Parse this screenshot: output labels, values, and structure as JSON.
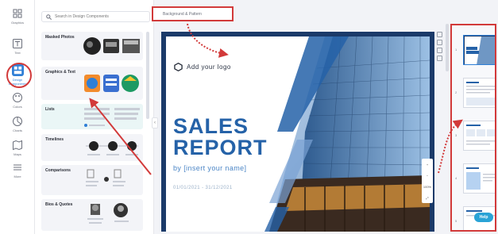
{
  "rail": {
    "items": [
      {
        "label": "Graphics",
        "icon": "graphics-icon"
      },
      {
        "label": "Text",
        "icon": "text-icon"
      },
      {
        "label": "Design Components",
        "icon": "design-components-icon"
      },
      {
        "label": "Colors",
        "icon": "palette-icon"
      },
      {
        "label": "Charts",
        "icon": "chart-icon"
      },
      {
        "label": "Maps",
        "icon": "map-icon"
      },
      {
        "label": "More",
        "icon": "grid-icon"
      }
    ]
  },
  "panel": {
    "search_placeholder": "Search in Design Components",
    "categories": [
      {
        "label": "Masked Photos"
      },
      {
        "label": "Graphics & Text"
      },
      {
        "label": "Lists"
      },
      {
        "label": "Timelines"
      },
      {
        "label": "Comparisons"
      },
      {
        "label": "Bios & Quotes"
      }
    ]
  },
  "tab": {
    "label": "Background & Pattern"
  },
  "canvas": {
    "logo_text": "Add your logo",
    "title_line1": "SALES",
    "title_line2": "REPORT",
    "byline": "by [insert your name]",
    "dates": "01/01/2021 - 31/12/2021"
  },
  "zoom": {
    "plus": "+",
    "minus": "−",
    "level": "100%"
  },
  "pages": {
    "numbers": [
      "1",
      "2",
      "3",
      "4",
      "5"
    ]
  },
  "help": {
    "label": "Help"
  },
  "colors": {
    "accent": "#2f7fd6",
    "title": "#2562a8",
    "annotation": "#d23a3a",
    "frame": "#1b3a69"
  }
}
